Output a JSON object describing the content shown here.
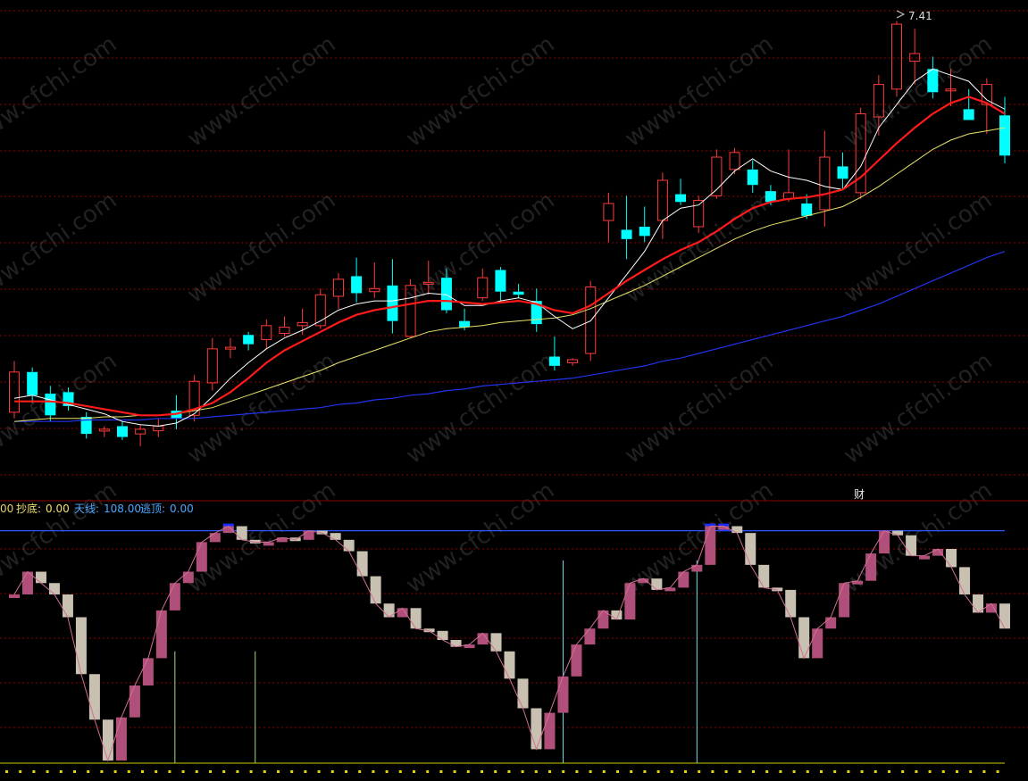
{
  "upper_chart": {
    "max_label": "7.41",
    "cai_badge": "财"
  },
  "indicator_legend": {
    "prefix": "00",
    "chaodi_label": "抄底:",
    "chaodi_value": "0.00",
    "tianxian_label": "天线:",
    "tianxian_value": "108.00",
    "taoding_label": "逃顶:",
    "taoding_value": "0.00"
  },
  "watermark": "www.cfchi.com",
  "colors": {
    "background": "#000000",
    "up_candle": "#ff3b3b",
    "down_candle": "#00ffff",
    "ma_white": "#ffffff",
    "ma_red": "#ff1a1a",
    "ma_yellow": "#e8e36a",
    "ma_blue": "#2233ee",
    "grid": "#8b0000",
    "pink_bar": "#b0507a",
    "gray_bar": "#c8c0b0",
    "top_bar": "#1a9fff",
    "signal_line": "#3355ff"
  },
  "chart_data": [
    {
      "type": "candlestick",
      "title": "",
      "max_annotation": 7.41,
      "candles": [
        {
          "o": 4.86,
          "h": 5.19,
          "l": 4.82,
          "c": 5.12
        },
        {
          "o": 5.12,
          "h": 5.15,
          "l": 4.92,
          "c": 4.97
        },
        {
          "o": 4.98,
          "h": 5.03,
          "l": 4.8,
          "c": 4.84
        },
        {
          "o": 4.99,
          "h": 5.02,
          "l": 4.87,
          "c": 4.9
        },
        {
          "o": 4.83,
          "h": 4.86,
          "l": 4.69,
          "c": 4.72
        },
        {
          "o": 4.74,
          "h": 4.77,
          "l": 4.7,
          "c": 4.75
        },
        {
          "o": 4.77,
          "h": 4.8,
          "l": 4.68,
          "c": 4.7
        },
        {
          "o": 4.72,
          "h": 4.78,
          "l": 4.64,
          "c": 4.75
        },
        {
          "o": 4.74,
          "h": 4.82,
          "l": 4.7,
          "c": 4.77
        },
        {
          "o": 4.87,
          "h": 4.97,
          "l": 4.75,
          "c": 4.82
        },
        {
          "o": 4.84,
          "h": 5.1,
          "l": 4.8,
          "c": 5.06
        },
        {
          "o": 5.05,
          "h": 5.34,
          "l": 5.0,
          "c": 5.27
        },
        {
          "o": 5.27,
          "h": 5.34,
          "l": 5.21,
          "c": 5.28
        },
        {
          "o": 5.36,
          "h": 5.38,
          "l": 5.26,
          "c": 5.3
        },
        {
          "o": 5.33,
          "h": 5.46,
          "l": 5.27,
          "c": 5.42
        },
        {
          "o": 5.37,
          "h": 5.48,
          "l": 5.35,
          "c": 5.41
        },
        {
          "o": 5.42,
          "h": 5.53,
          "l": 5.36,
          "c": 5.44
        },
        {
          "o": 5.42,
          "h": 5.66,
          "l": 5.4,
          "c": 5.62
        },
        {
          "o": 5.61,
          "h": 5.76,
          "l": 5.53,
          "c": 5.72
        },
        {
          "o": 5.74,
          "h": 5.86,
          "l": 5.57,
          "c": 5.63
        },
        {
          "o": 5.64,
          "h": 5.83,
          "l": 5.6,
          "c": 5.66
        },
        {
          "o": 5.68,
          "h": 5.85,
          "l": 5.37,
          "c": 5.45
        },
        {
          "o": 5.35,
          "h": 5.72,
          "l": 5.34,
          "c": 5.68
        },
        {
          "o": 5.69,
          "h": 5.84,
          "l": 5.62,
          "c": 5.7
        },
        {
          "o": 5.73,
          "h": 5.79,
          "l": 5.5,
          "c": 5.52
        },
        {
          "o": 5.45,
          "h": 5.53,
          "l": 5.39,
          "c": 5.41
        },
        {
          "o": 5.6,
          "h": 5.79,
          "l": 5.58,
          "c": 5.73
        },
        {
          "o": 5.78,
          "h": 5.8,
          "l": 5.58,
          "c": 5.64
        },
        {
          "o": 5.64,
          "h": 5.69,
          "l": 5.6,
          "c": 5.62
        },
        {
          "o": 5.58,
          "h": 5.66,
          "l": 5.38,
          "c": 5.43
        },
        {
          "o": 5.22,
          "h": 5.35,
          "l": 5.13,
          "c": 5.16
        },
        {
          "o": 5.18,
          "h": 5.21,
          "l": 5.16,
          "c": 5.2
        },
        {
          "o": 5.24,
          "h": 5.71,
          "l": 5.19,
          "c": 5.67
        },
        {
          "o": 6.1,
          "h": 6.28,
          "l": 5.96,
          "c": 6.21
        },
        {
          "o": 6.04,
          "h": 6.26,
          "l": 5.85,
          "c": 5.98
        },
        {
          "o": 6.06,
          "h": 6.19,
          "l": 5.96,
          "c": 6.0
        },
        {
          "o": 6.1,
          "h": 6.41,
          "l": 5.98,
          "c": 6.36
        },
        {
          "o": 6.27,
          "h": 6.37,
          "l": 6.2,
          "c": 6.22
        },
        {
          "o": 6.06,
          "h": 6.26,
          "l": 6.02,
          "c": 6.23
        },
        {
          "o": 6.26,
          "h": 6.56,
          "l": 6.24,
          "c": 6.51
        },
        {
          "o": 6.43,
          "h": 6.57,
          "l": 6.4,
          "c": 6.54
        },
        {
          "o": 6.43,
          "h": 6.49,
          "l": 6.28,
          "c": 6.33
        },
        {
          "o": 6.29,
          "h": 6.33,
          "l": 6.2,
          "c": 6.22
        },
        {
          "o": 6.24,
          "h": 6.56,
          "l": 6.22,
          "c": 6.28
        },
        {
          "o": 6.21,
          "h": 6.27,
          "l": 6.11,
          "c": 6.13
        },
        {
          "o": 6.17,
          "h": 6.68,
          "l": 6.06,
          "c": 6.51
        },
        {
          "o": 6.45,
          "h": 6.54,
          "l": 6.3,
          "c": 6.37
        },
        {
          "o": 6.28,
          "h": 6.83,
          "l": 6.24,
          "c": 6.79
        },
        {
          "o": 6.77,
          "h": 7.04,
          "l": 6.65,
          "c": 6.98
        },
        {
          "o": 6.95,
          "h": 7.39,
          "l": 6.9,
          "c": 7.37
        },
        {
          "o": 7.13,
          "h": 7.34,
          "l": 6.98,
          "c": 7.18
        },
        {
          "o": 7.08,
          "h": 7.16,
          "l": 6.89,
          "c": 6.93
        },
        {
          "o": 6.95,
          "h": 7.08,
          "l": 6.84,
          "c": 6.95
        },
        {
          "o": 6.82,
          "h": 6.95,
          "l": 6.76,
          "c": 6.75
        },
        {
          "o": 6.85,
          "h": 7.02,
          "l": 6.66,
          "c": 6.98
        },
        {
          "o": 6.78,
          "h": 6.9,
          "l": 6.47,
          "c": 6.52
        }
      ],
      "ma_white": [
        4.95,
        4.97,
        4.94,
        4.91,
        4.88,
        4.85,
        4.8,
        4.78,
        4.77,
        4.79,
        4.85,
        4.96,
        5.08,
        5.18,
        5.27,
        5.34,
        5.39,
        5.45,
        5.52,
        5.56,
        5.58,
        5.58,
        5.6,
        5.63,
        5.62,
        5.55,
        5.55,
        5.58,
        5.6,
        5.57,
        5.48,
        5.4,
        5.45,
        5.6,
        5.75,
        5.9,
        6.1,
        6.18,
        6.2,
        6.3,
        6.42,
        6.5,
        6.42,
        6.38,
        6.36,
        6.32,
        6.3,
        6.45,
        6.7,
        6.85,
        7.0,
        7.08,
        7.04,
        7.0,
        6.88,
        6.82
      ],
      "ma_red": [
        4.93,
        4.93,
        4.93,
        4.92,
        4.9,
        4.88,
        4.86,
        4.84,
        4.84,
        4.85,
        4.88,
        4.92,
        4.99,
        5.08,
        5.18,
        5.26,
        5.32,
        5.38,
        5.44,
        5.49,
        5.52,
        5.54,
        5.56,
        5.58,
        5.58,
        5.57,
        5.56,
        5.57,
        5.58,
        5.56,
        5.52,
        5.5,
        5.55,
        5.63,
        5.71,
        5.78,
        5.85,
        5.91,
        5.96,
        6.03,
        6.11,
        6.18,
        6.22,
        6.24,
        6.25,
        6.27,
        6.3,
        6.38,
        6.49,
        6.6,
        6.7,
        6.79,
        6.86,
        6.9,
        6.86,
        6.79
      ],
      "ma_yellow": [
        4.8,
        4.81,
        4.82,
        4.82,
        4.82,
        4.83,
        4.83,
        4.84,
        4.84,
        4.85,
        4.87,
        4.89,
        4.93,
        4.97,
        5.01,
        5.05,
        5.09,
        5.13,
        5.18,
        5.22,
        5.26,
        5.3,
        5.34,
        5.38,
        5.4,
        5.41,
        5.42,
        5.44,
        5.45,
        5.46,
        5.47,
        5.49,
        5.53,
        5.58,
        5.63,
        5.68,
        5.74,
        5.8,
        5.86,
        5.92,
        5.98,
        6.03,
        6.07,
        6.1,
        6.13,
        6.16,
        6.19,
        6.25,
        6.32,
        6.4,
        6.48,
        6.56,
        6.62,
        6.66,
        6.68,
        6.7
      ],
      "ma_blue": [
        4.8,
        4.8,
        4.8,
        4.8,
        4.81,
        4.81,
        4.81,
        4.81,
        4.82,
        4.82,
        4.82,
        4.83,
        4.84,
        4.85,
        4.86,
        4.87,
        4.88,
        4.89,
        4.91,
        4.92,
        4.94,
        4.95,
        4.97,
        4.98,
        5.0,
        5.01,
        5.03,
        5.04,
        5.05,
        5.06,
        5.07,
        5.08,
        5.1,
        5.12,
        5.14,
        5.16,
        5.19,
        5.21,
        5.24,
        5.27,
        5.3,
        5.33,
        5.36,
        5.39,
        5.42,
        5.45,
        5.48,
        5.52,
        5.56,
        5.61,
        5.66,
        5.71,
        5.76,
        5.81,
        5.86,
        5.9
      ]
    },
    {
      "type": "bar",
      "title": "",
      "ylim": [
        0,
        120
      ],
      "tianxian": 108,
      "values": [
        80,
        90,
        85,
        80,
        70,
        45,
        25,
        7,
        26,
        40,
        52,
        73,
        85,
        90,
        103,
        107,
        110,
        104,
        103,
        103,
        105,
        104,
        108,
        107,
        104,
        99,
        88,
        76,
        70,
        74,
        65,
        64,
        60,
        57,
        58,
        63,
        55,
        43,
        30,
        12,
        28,
        44,
        58,
        65,
        73,
        69,
        85,
        87,
        82,
        83,
        90,
        93,
        110,
        110,
        107,
        93,
        83,
        82,
        70,
        52,
        65,
        70,
        85,
        86,
        98,
        108,
        106,
        97,
        97,
        100,
        92,
        80,
        72,
        76,
        65
      ],
      "spikes": [
        {
          "bar": 12,
          "height": 55,
          "color": "green"
        },
        {
          "bar": 18,
          "height": 55,
          "color": "green"
        },
        {
          "bar": 41,
          "height": 95,
          "color": "cyan"
        },
        {
          "bar": 51,
          "height": 95,
          "color": "cyan"
        }
      ]
    }
  ]
}
